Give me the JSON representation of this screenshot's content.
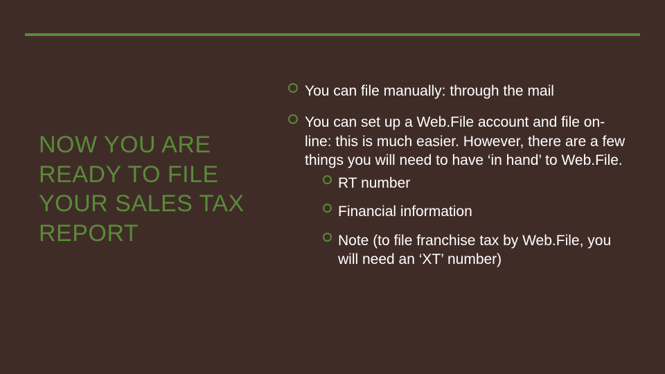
{
  "title": "NOW YOU ARE READY TO FILE YOUR SALES TAX REPORT",
  "bullets": [
    "You can file manually: through the mail",
    "You can set up a Web.File account and file on-line:  this is much easier.  However, there are a few things you will need to have ‘in hand’ to Web.File."
  ],
  "sub_bullets": [
    "RT number",
    "Financial information",
    "Note (to file franchise tax by Web.File, you will need an ‘XT’ number)"
  ]
}
